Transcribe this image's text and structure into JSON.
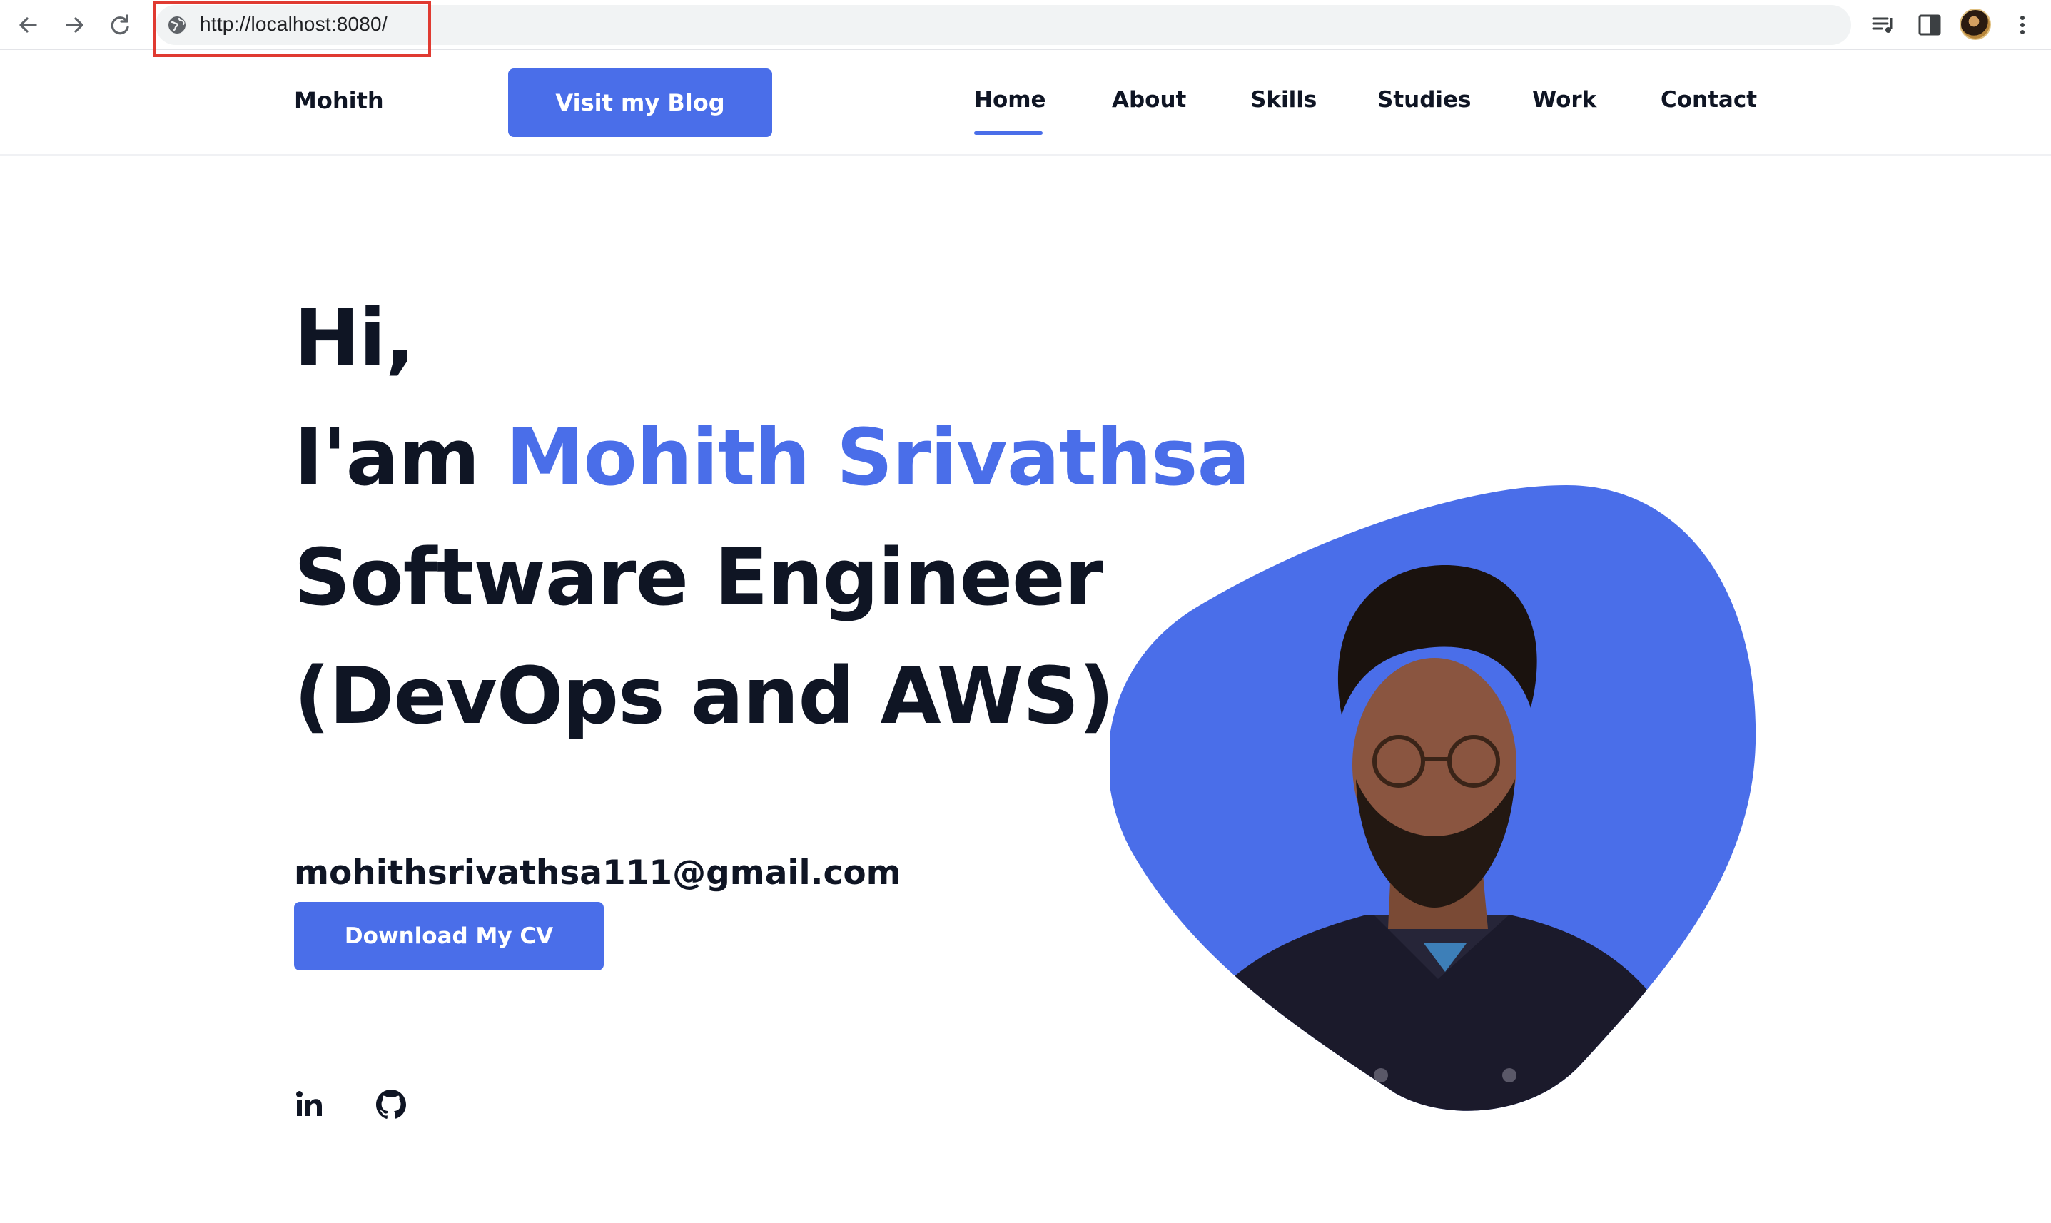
{
  "browser": {
    "url": "http://localhost:8080/",
    "icons": [
      "back-arrow-icon",
      "forward-arrow-icon",
      "reload-icon",
      "globe-icon",
      "media-playlist-icon",
      "side-panel-icon",
      "profile-avatar",
      "more-vertical-icon"
    ]
  },
  "header": {
    "brand": "Mohith",
    "blog_button": "Visit my Blog",
    "nav": [
      "Home",
      "About",
      "Skills",
      "Studies",
      "Work",
      "Contact"
    ],
    "active_nav": "Home"
  },
  "hero": {
    "greeting": "Hi,",
    "intro_prefix": "I'am",
    "name": "Mohith Srivathsa",
    "role_line1": "Software Engineer",
    "role_line2": "(DevOps and AWS)",
    "email": "mohithsrivathsa111@gmail.com",
    "cv_button": "Download My CV",
    "social_icons": [
      "linkedin-icon",
      "github-icon"
    ]
  },
  "colors": {
    "accent": "#4a6ee9",
    "text": "#0f1524",
    "highlight_box": "#e03a31"
  }
}
